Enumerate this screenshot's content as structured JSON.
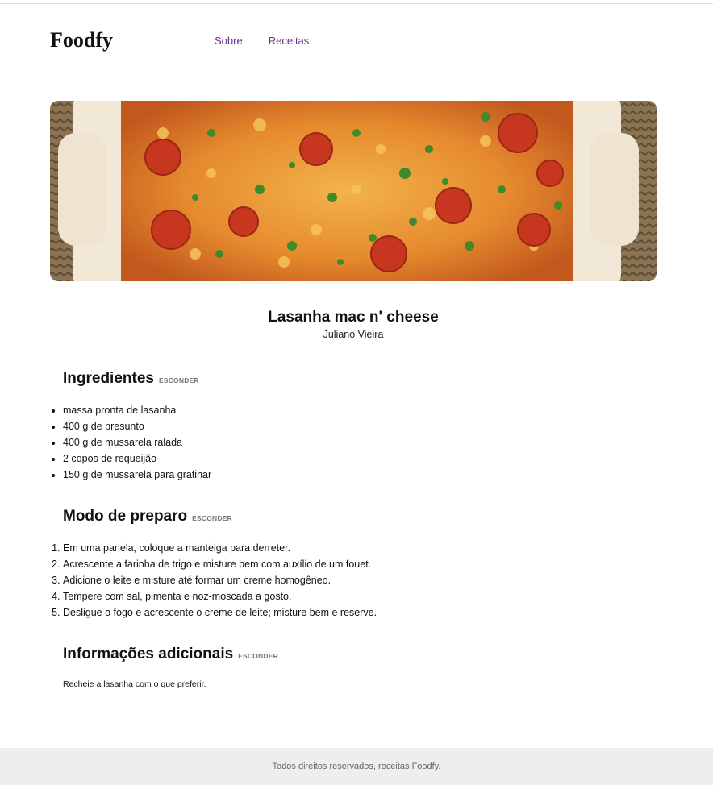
{
  "header": {
    "logo": "Foodfy",
    "nav": [
      "Sobre",
      "Receitas"
    ]
  },
  "hero": {
    "icon": "recipe-photo-lasanha"
  },
  "recipe": {
    "title": "Lasanha mac n' cheese",
    "author": "Juliano Vieira"
  },
  "sections": {
    "ingredients": {
      "title": "Ingredientes",
      "toggle": "ESCONDER",
      "items": [
        "massa pronta de lasanha",
        "400 g de presunto",
        "400 g de mussarela ralada",
        "2 copos de requeijão",
        "150 g de mussarela para gratinar"
      ]
    },
    "preparation": {
      "title": "Modo de preparo",
      "toggle": "ESCONDER",
      "steps": [
        "Em uma panela, coloque a manteiga para derreter.",
        "Acrescente a farinha de trigo e misture bem com auxílio de um fouet.",
        "Adicione o leite e misture até formar um creme homogêneo.",
        "Tempere com sal, pimenta e noz-moscada a gosto.",
        "Desligue o fogo e acrescente o creme de leite; misture bem e reserve."
      ]
    },
    "info": {
      "title": "Informações adicionais",
      "toggle": "ESCONDER",
      "text": "Recheie a lasanha com o que preferir."
    }
  },
  "footer": {
    "text": "Todos direitos reservados, receitas Foodfy."
  },
  "colors": {
    "nav_link": "#6b2c91",
    "footer_bg": "#eeeeee"
  }
}
